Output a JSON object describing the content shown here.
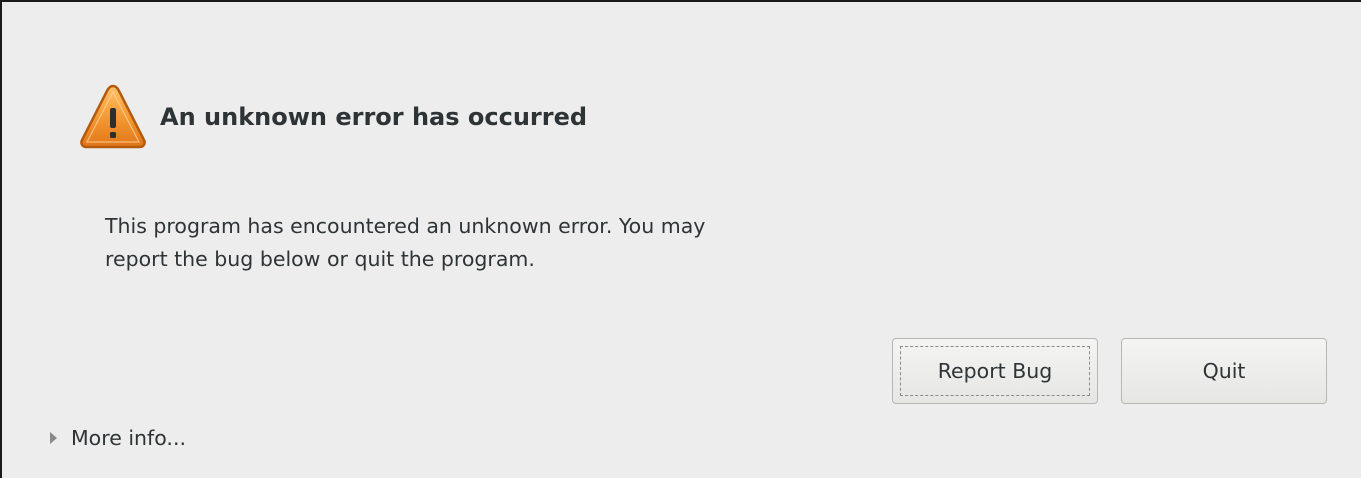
{
  "dialog": {
    "title": "An unknown error has occurred",
    "message_line1": "This program has encountered an unknown error. You may",
    "message_line2": "report the bug below or quit the program.",
    "icon": "warning-triangle-icon"
  },
  "buttons": {
    "report_bug": "Report Bug",
    "quit": "Quit"
  },
  "expander": {
    "label": "More info...",
    "expanded": false
  },
  "colors": {
    "background": "#ededed",
    "text": "#2e3436",
    "warning_orange": "#f08a24"
  }
}
